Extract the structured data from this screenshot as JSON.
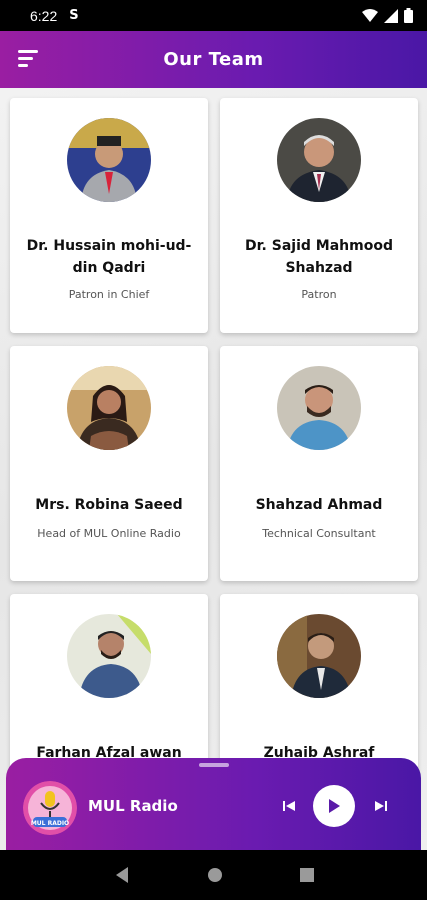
{
  "status_bar": {
    "time": "6:22",
    "sim_icon": "S"
  },
  "app_bar": {
    "title": "Our Team",
    "menu_icon": "sort-menu-icon"
  },
  "team": [
    {
      "name": "Dr. Hussain mohi-ud-din Qadri",
      "role": "Patron in Chief"
    },
    {
      "name": "Dr. Sajid Mahmood Shahzad",
      "role": "Patron"
    },
    {
      "name": "Mrs. Robina Saeed",
      "role": "Head of  MUL Online Radio"
    },
    {
      "name": "Shahzad Ahmad",
      "role": "Technical  Consultant"
    },
    {
      "name": "Farhan Afzal awan",
      "role": ""
    },
    {
      "name": "Zuhaib Ashraf",
      "role": ""
    }
  ],
  "player": {
    "station": "MUL Radio",
    "logo_text": "MUL RADIO"
  },
  "colors": {
    "gradient_start": "#9a1ea2",
    "gradient_end": "#4a17a6",
    "card_bg": "#ffffff"
  }
}
